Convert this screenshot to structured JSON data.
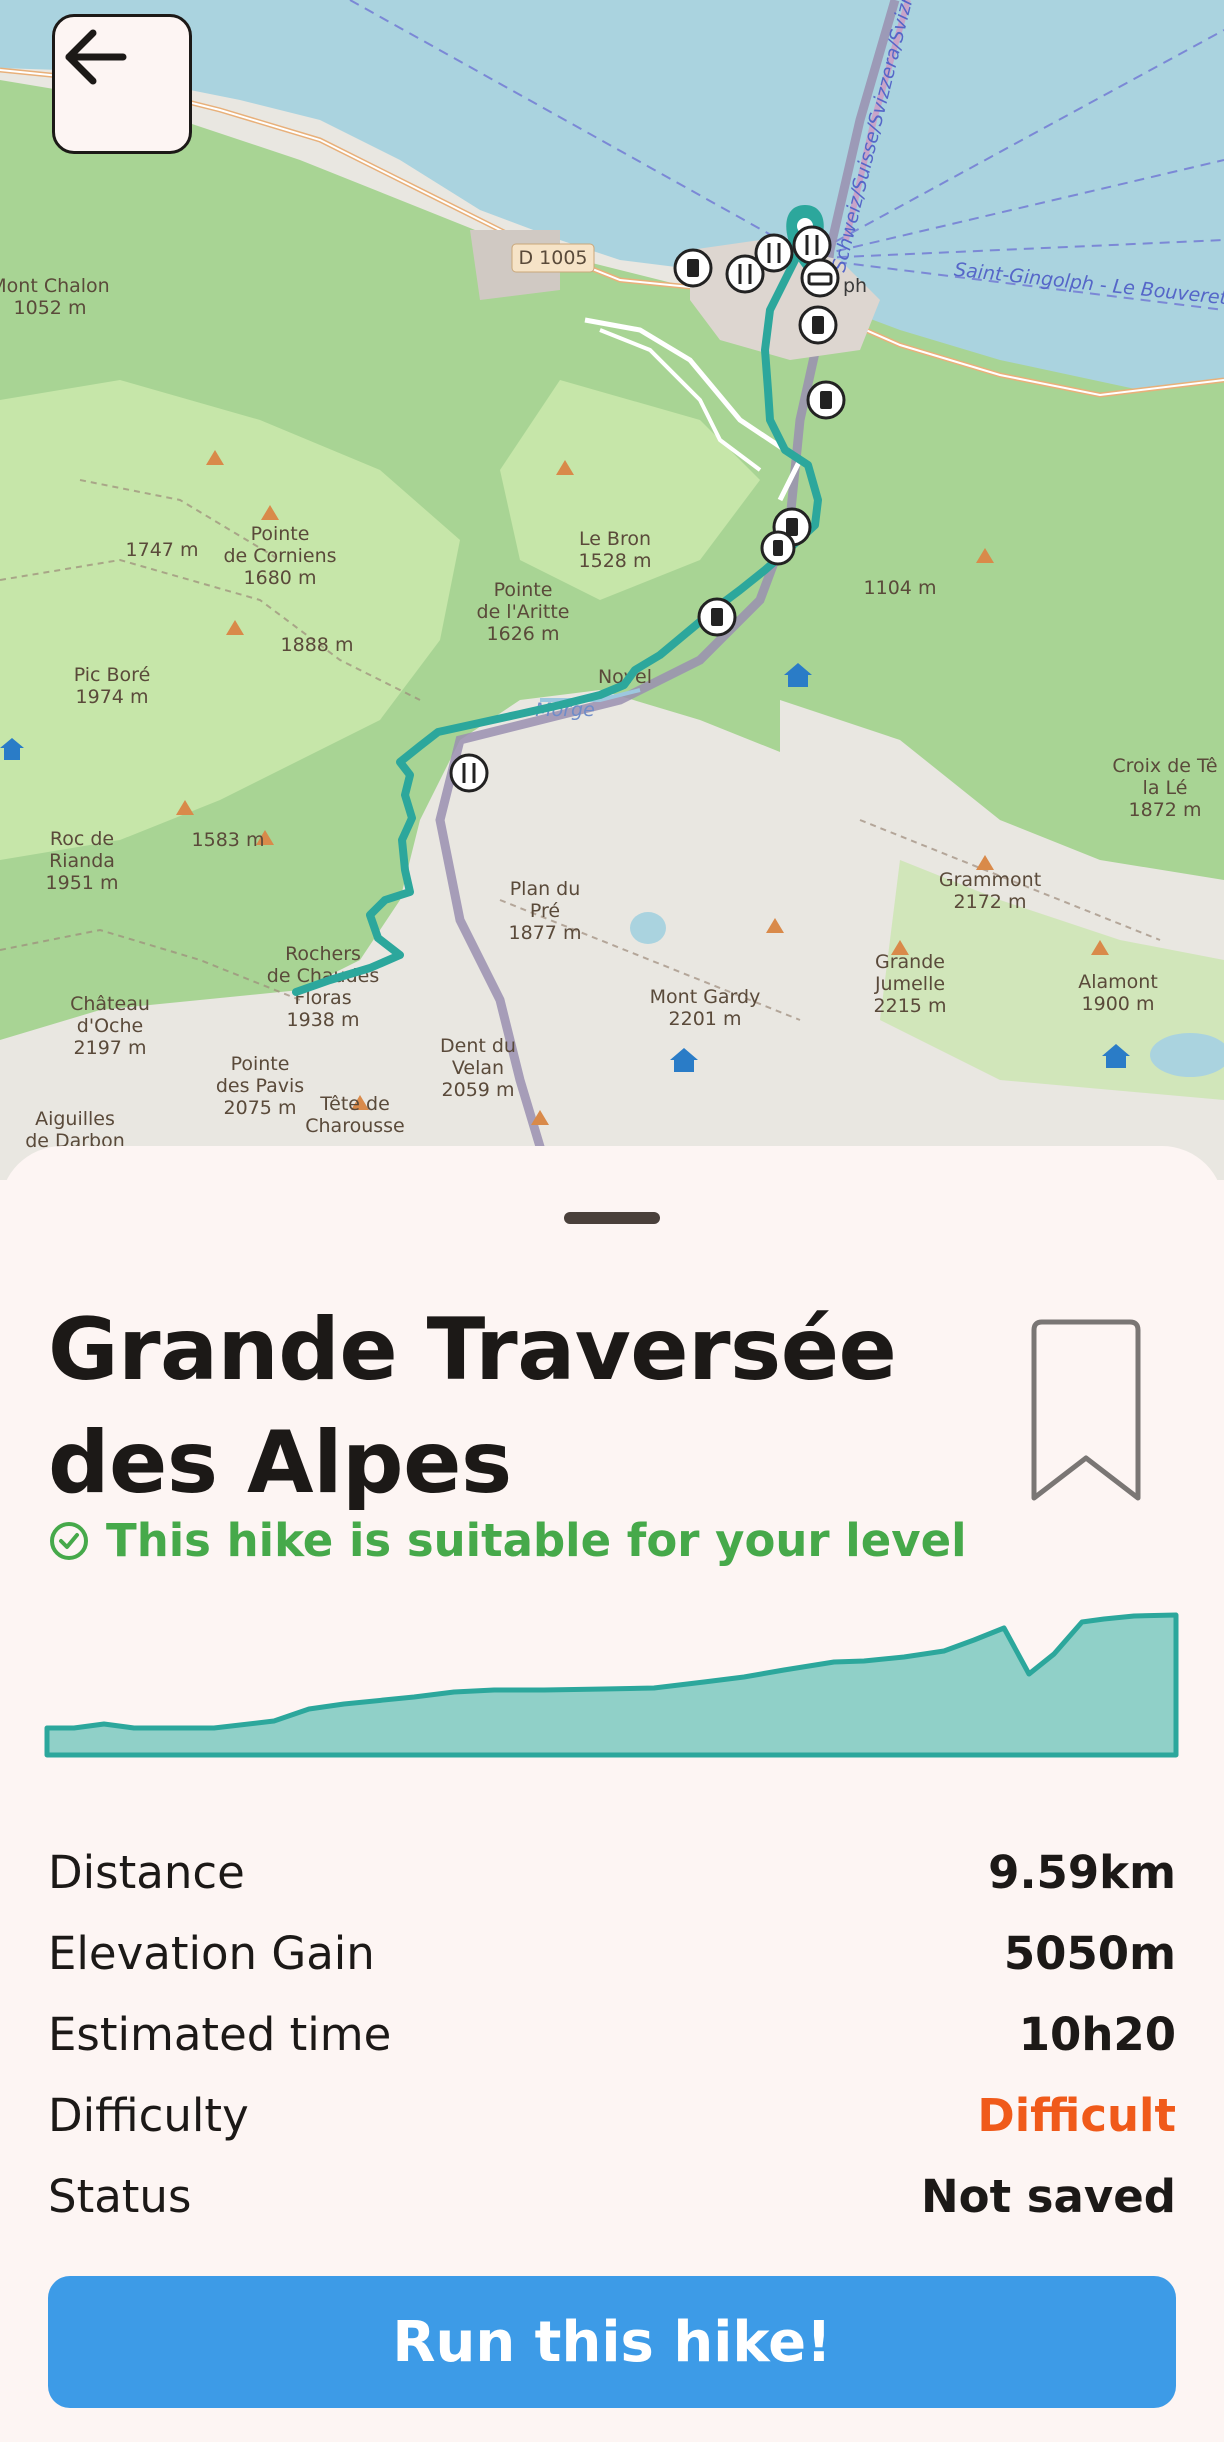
{
  "map": {
    "labels": [
      {
        "id": "mont-chalon",
        "lines": [
          "Mont Chalon",
          "1052 m"
        ]
      },
      {
        "id": "d1005",
        "lines": [
          "D 1005"
        ]
      },
      {
        "id": "pointe-corniens",
        "lines": [
          "Pointe",
          "de Corniens",
          "1680 m"
        ]
      },
      {
        "id": "m1747",
        "lines": [
          "1747 m"
        ]
      },
      {
        "id": "le-bron",
        "lines": [
          "Le Bron",
          "1528 m"
        ]
      },
      {
        "id": "pointe-aritte",
        "lines": [
          "Pointe",
          "de l'Aritte",
          "1626 m"
        ]
      },
      {
        "id": "m1888",
        "lines": [
          "1888 m"
        ]
      },
      {
        "id": "pic-bore",
        "lines": [
          "Pic Boré",
          "1974 m"
        ]
      },
      {
        "id": "m1104",
        "lines": [
          "1104 m"
        ]
      },
      {
        "id": "novel",
        "lines": [
          "Novel"
        ]
      },
      {
        "id": "morge",
        "lines": [
          "Morge"
        ]
      },
      {
        "id": "roc-de-rianda",
        "lines": [
          "Roc de",
          "Rianda",
          "1951 m"
        ]
      },
      {
        "id": "m1583",
        "lines": [
          "1583 m"
        ]
      },
      {
        "id": "croix-de-te",
        "lines": [
          "Croix de Tê",
          "la Lé",
          "1872 m"
        ]
      },
      {
        "id": "grammont",
        "lines": [
          "Grammont",
          "2172 m"
        ]
      },
      {
        "id": "plan-du-pre",
        "lines": [
          "Plan du",
          "Pré",
          "1877 m"
        ]
      },
      {
        "id": "grande-jumelle",
        "lines": [
          "Grande",
          "Jumelle",
          "2215 m"
        ]
      },
      {
        "id": "rochers",
        "lines": [
          "Rochers",
          "de Chaudes",
          "Floras",
          "1938 m"
        ]
      },
      {
        "id": "chateau-oche",
        "lines": [
          "Château",
          "d'Oche",
          "2197 m"
        ]
      },
      {
        "id": "mont-gardy",
        "lines": [
          "Mont Gardy",
          "2201 m"
        ]
      },
      {
        "id": "alamont",
        "lines": [
          "Alamont",
          "1900 m"
        ]
      },
      {
        "id": "dent-du-velan",
        "lines": [
          "Dent du",
          "Velan",
          "2059 m"
        ]
      },
      {
        "id": "pointe-pavis",
        "lines": [
          "Pointe",
          "des Pavis",
          "2075 m"
        ]
      },
      {
        "id": "tete-charousse",
        "lines": [
          "Tête de",
          "Charousse"
        ]
      },
      {
        "id": "aiguilles",
        "lines": [
          "Aiguilles",
          "de Darbon"
        ]
      },
      {
        "id": "saint-gingolph",
        "lines": [
          "Saint-Gingolph - Le Bouveret"
        ]
      },
      {
        "id": "border",
        "lines": [
          "Schweiz/Suisse/Svizzera/Svizra"
        ]
      },
      {
        "id": "town",
        "lines": [
          "ph"
        ]
      }
    ]
  },
  "colors": {
    "trail": "#2ca79c",
    "accent": "#3d9be7",
    "difficulty": "#f05a1a",
    "suitable": "#46a94a"
  },
  "icons": {
    "back": "arrow-left-icon",
    "bookmark": "bookmark-icon",
    "check": "check-circle-icon",
    "drink": "drinking-water-icon",
    "restaurant": "restaurant-icon"
  },
  "hike": {
    "title": "Grande Traversée des Alpes",
    "suitability": "This hike is suitable for your level",
    "stats": [
      {
        "label": "Distance",
        "value": "9.59km"
      },
      {
        "label": "Elevation Gain",
        "value": "5050m"
      },
      {
        "label": "Estimated time",
        "value": "10h20"
      },
      {
        "label": "Difficulty",
        "value": "Difficult"
      },
      {
        "label": "Status",
        "value": "Not saved"
      }
    ]
  },
  "actions": {
    "run": "Run this hike!"
  }
}
